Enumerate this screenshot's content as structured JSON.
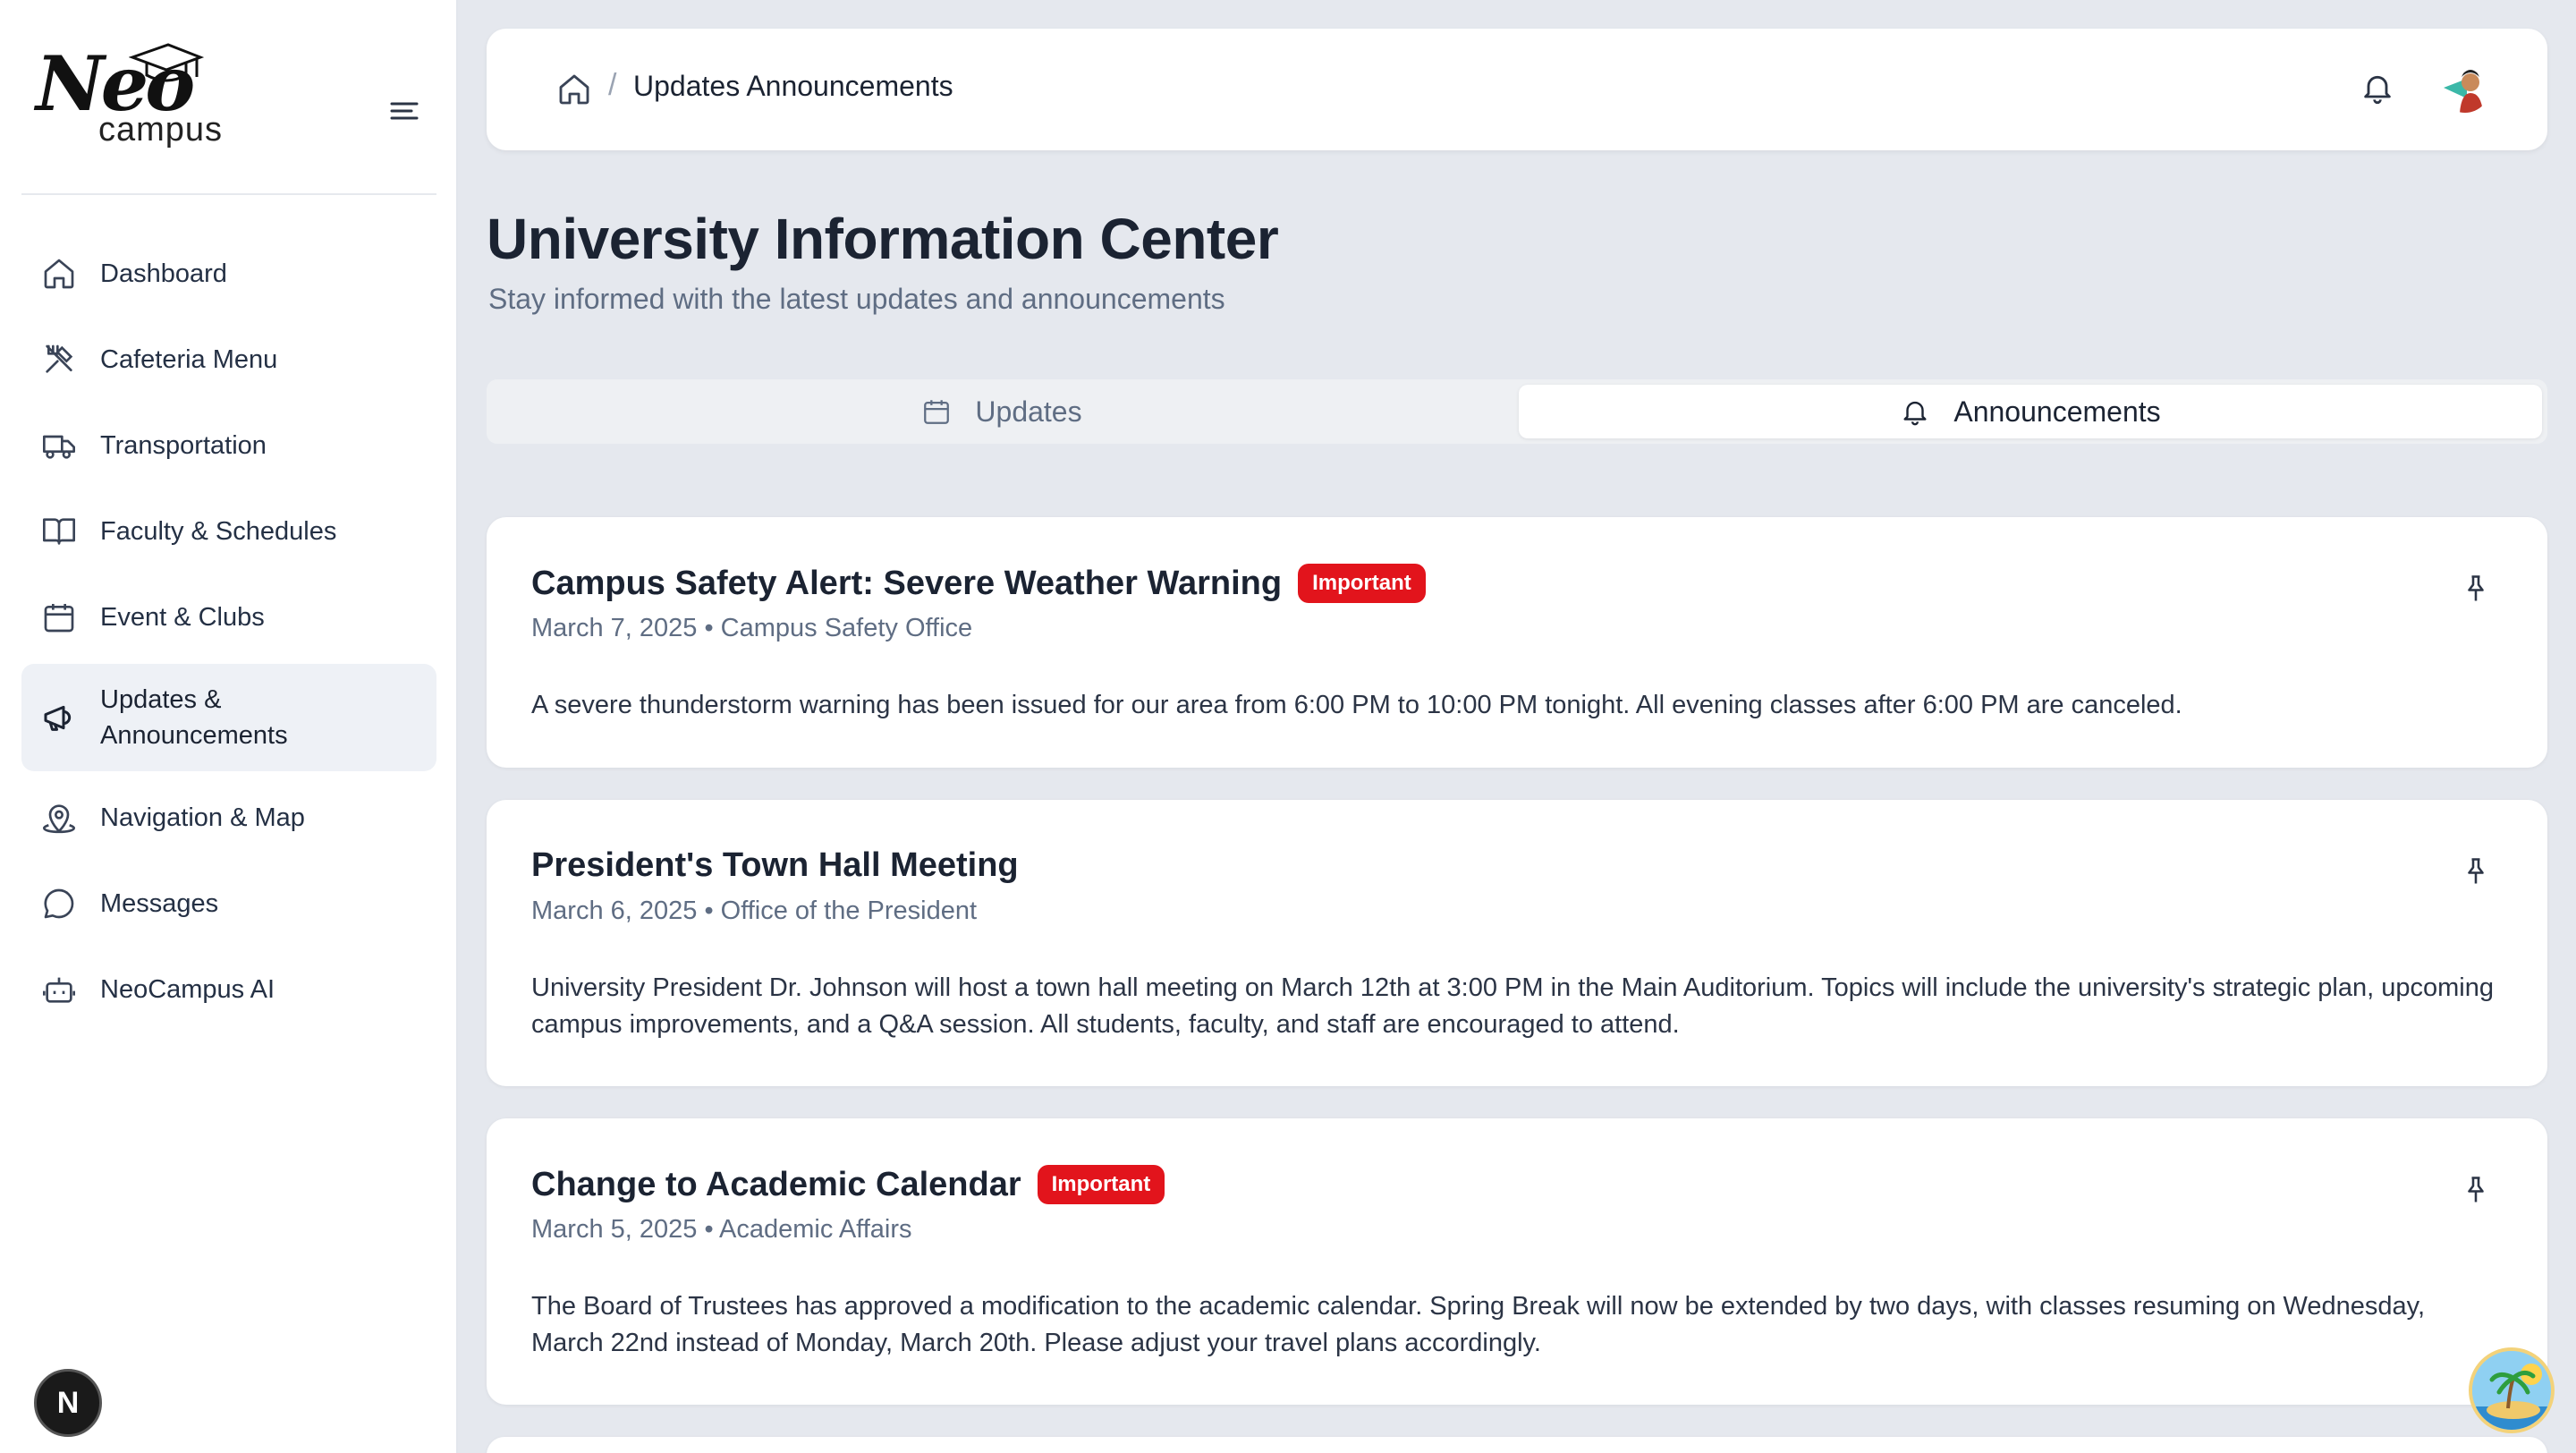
{
  "sidebar": {
    "logo_main": "Neo",
    "logo_sub": "campus",
    "items": [
      {
        "label": "Dashboard",
        "icon": "home-icon"
      },
      {
        "label": "Cafeteria Menu",
        "icon": "utensils-icon"
      },
      {
        "label": "Transportation",
        "icon": "truck-icon"
      },
      {
        "label": "Faculty & Schedules",
        "icon": "book-icon"
      },
      {
        "label": "Event & Clubs",
        "icon": "calendar-icon"
      },
      {
        "label_line1": "Updates &",
        "label_line2": "Announcements",
        "icon": "megaphone-icon",
        "active": true
      },
      {
        "label": "Navigation & Map",
        "icon": "map-pin-icon"
      },
      {
        "label": "Messages",
        "icon": "message-icon"
      },
      {
        "label": "NeoCampus AI",
        "icon": "bot-icon"
      }
    ],
    "dev_badge": "N"
  },
  "header": {
    "breadcrumb_current": "Updates Announcements",
    "breadcrumb_separator": "/"
  },
  "main": {
    "title": "University Information Center",
    "subtitle": "Stay informed with the latest updates and announcements",
    "tabs": [
      {
        "label": "Updates",
        "icon": "calendar-icon",
        "selected": false
      },
      {
        "label": "Announcements",
        "icon": "bell-icon",
        "selected": true
      }
    ],
    "announcements": [
      {
        "title": "Campus Safety Alert: Severe Weather Warning",
        "badge": "Important",
        "date": "March 7, 2025",
        "source": "Campus Safety Office",
        "meta": "March 7, 2025 • Campus Safety Office",
        "body": "A severe thunderstorm warning has been issued for our area from 6:00 PM to 10:00 PM tonight. All evening classes after 6:00 PM are canceled."
      },
      {
        "title": "President's Town Hall Meeting",
        "badge": "",
        "date": "March 6, 2025",
        "source": "Office of the President",
        "meta": "March 6, 2025 • Office of the President",
        "body": "University President Dr. Johnson will host a town hall meeting on March 12th at 3:00 PM in the Main Auditorium. Topics will include the university's strategic plan, upcoming campus improvements, and a Q&A session. All students, faculty, and staff are encouraged to attend."
      },
      {
        "title": "Change to Academic Calendar",
        "badge": "Important",
        "date": "March 5, 2025",
        "source": "Academic Affairs",
        "meta": "March 5, 2025 • Academic Affairs",
        "body": "The Board of Trustees has approved a modification to the academic calendar. Spring Break will now be extended by two days, with classes resuming on Wednesday, March 22nd instead of Monday, March 20th. Please adjust your travel plans accordingly."
      }
    ]
  },
  "colors": {
    "accent_important": "#e2141c",
    "page_bg": "#e5e8ee",
    "text_primary": "#1b2332",
    "text_muted": "#5f6d83"
  }
}
